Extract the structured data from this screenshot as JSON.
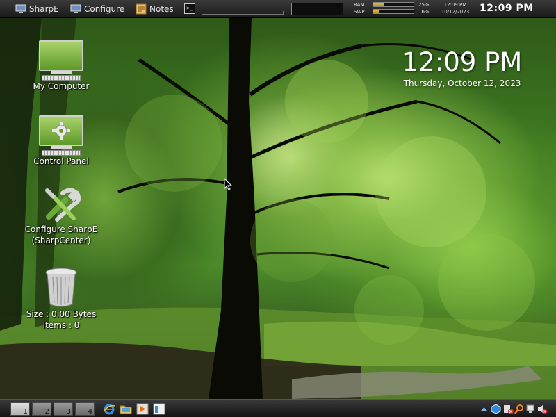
{
  "top_panel": {
    "menu_sharpe": "SharpE",
    "menu_configure": "Configure",
    "menu_notes": "Notes",
    "terminal_glyph": ">_",
    "ram_label": "RAM",
    "swp_label": "SWP",
    "ram_percent": "25%",
    "swp_percent": "16%",
    "ram_fraction": 0.25,
    "swp_fraction": 0.16,
    "mini_time": "12:09 PM",
    "mini_date": "10/12/2023",
    "clock": "12:09 PM"
  },
  "desktop": {
    "icons": [
      {
        "label": "My Computer"
      },
      {
        "label": "Control Panel"
      },
      {
        "label_line1": "Configure SharpE",
        "label_line2": "(SharpCenter)"
      },
      {
        "label_line1": "Size : 0.00 Bytes",
        "label_line2": "Items : 0"
      }
    ],
    "clock_time": "12:09 PM",
    "clock_date": "Thursday, October 12, 2023"
  },
  "bottom_panel": {
    "workspaces": [
      "1",
      "2",
      "3",
      "4"
    ],
    "active_workspace": "1"
  },
  "colors": {
    "panel": "#1e1e1e",
    "meter_fill": "#d4b23a",
    "text": "#ffffff"
  }
}
